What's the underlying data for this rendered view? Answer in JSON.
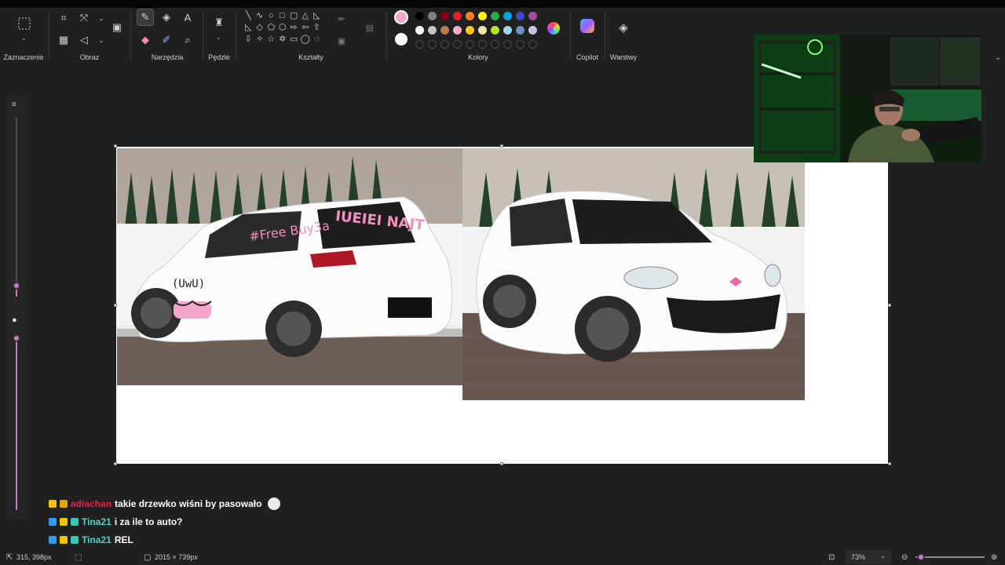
{
  "ribbon": {
    "groups": {
      "selection": "Zaznaczenie",
      "image": "Obraz",
      "tools": "Narzędzia",
      "brushes": "Pędzle",
      "shapes": "Kształty",
      "colors": "Kolory",
      "copilot": "Copilot",
      "layers": "Warstwy"
    },
    "primary_color": "#f4a6c9",
    "secondary_color": "#ffffff",
    "palette_row1": [
      "#000000",
      "#7f7f7f",
      "#880015",
      "#ed1c24",
      "#ff7f27",
      "#fff200",
      "#22b14c",
      "#00a2e8",
      "#3f48cc",
      "#a349a4"
    ],
    "palette_row2": [
      "#ffffff",
      "#c3c3c3",
      "#b97a57",
      "#ffaec9",
      "#ffc90e",
      "#efe4b0",
      "#b5e61d",
      "#99d9ea",
      "#7092be",
      "#c8bfe7"
    ]
  },
  "canvas": {
    "left_photo_text_1": "#Free Buy3a",
    "left_photo_text_2": "IUEIEI NAJT",
    "left_photo_face": "(UwU)"
  },
  "chat": [
    {
      "user": "adiachan",
      "user_color": "#e0244a",
      "message": "takie drzewko wiśni by pasowało"
    },
    {
      "user": "Tina21",
      "user_color": "#4fd1c5",
      "message": "i za ile to auto?"
    },
    {
      "user": "Tina21",
      "user_color": "#4fd1c5",
      "message": "REL"
    }
  ],
  "status": {
    "cursor_pos": "315, 398px",
    "canvas_size": "2015 × 739px",
    "zoom": "73%",
    "zoom_fraction": 0.08
  }
}
